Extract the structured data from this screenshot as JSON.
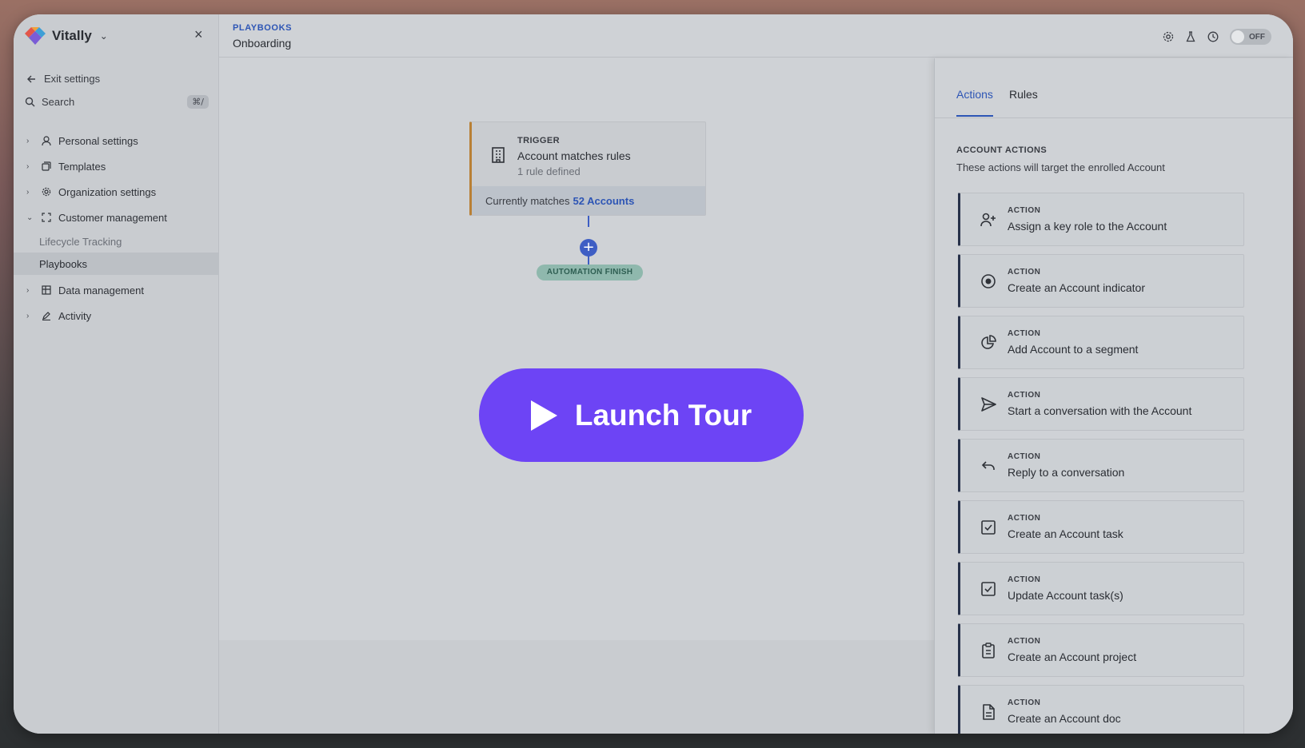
{
  "app": {
    "name": "Vitally"
  },
  "sidebar": {
    "exit_label": "Exit settings",
    "search_placeholder": "Search",
    "search_shortcut": "⌘/",
    "items": [
      {
        "label": "Personal settings",
        "icon": "person-icon",
        "expanded": false
      },
      {
        "label": "Templates",
        "icon": "templates-icon",
        "expanded": false
      },
      {
        "label": "Organization settings",
        "icon": "gear-icon",
        "expanded": false
      },
      {
        "label": "Customer management",
        "icon": "customer-management-icon",
        "expanded": true,
        "children": [
          {
            "label": "Lifecycle Tracking",
            "active": false
          },
          {
            "label": "Playbooks",
            "active": true
          }
        ]
      },
      {
        "label": "Data management",
        "icon": "table-icon",
        "expanded": false
      },
      {
        "label": "Activity",
        "icon": "pencil-icon",
        "expanded": false
      }
    ]
  },
  "header": {
    "breadcrumb": "PLAYBOOKS",
    "title": "Onboarding",
    "toggle_label": "OFF"
  },
  "canvas": {
    "trigger": {
      "label": "TRIGGER",
      "title": "Account matches rules",
      "subtitle": "1 rule defined",
      "footer_text": "Currently matches",
      "footer_link": "52 Accounts"
    },
    "finish_label": "AUTOMATION FINISH"
  },
  "tour": {
    "label": "Launch Tour"
  },
  "panel": {
    "tabs": [
      {
        "label": "Actions",
        "active": true
      },
      {
        "label": "Rules",
        "active": false
      }
    ],
    "section_title": "ACCOUNT ACTIONS",
    "section_subtitle": "These actions will target the enrolled Account",
    "action_label": "ACTION",
    "actions": [
      {
        "title": "Assign a key role to the Account",
        "icon": "user-plus-icon"
      },
      {
        "title": "Create an Account indicator",
        "icon": "indicator-icon"
      },
      {
        "title": "Add Account to a segment",
        "icon": "pie-chart-icon"
      },
      {
        "title": "Start a conversation with the Account",
        "icon": "send-icon"
      },
      {
        "title": "Reply to a conversation",
        "icon": "reply-icon"
      },
      {
        "title": "Create an Account task",
        "icon": "checkbox-icon"
      },
      {
        "title": "Update Account task(s)",
        "icon": "checkbox-icon"
      },
      {
        "title": "Create an Account project",
        "icon": "clipboard-icon"
      },
      {
        "title": "Create an Account doc",
        "icon": "document-icon"
      }
    ]
  },
  "colors": {
    "accent": "#2d55b5",
    "trigger_border": "#b98035",
    "launch_button": "#6d44f5",
    "finish_badge": "#8fb8ad"
  }
}
